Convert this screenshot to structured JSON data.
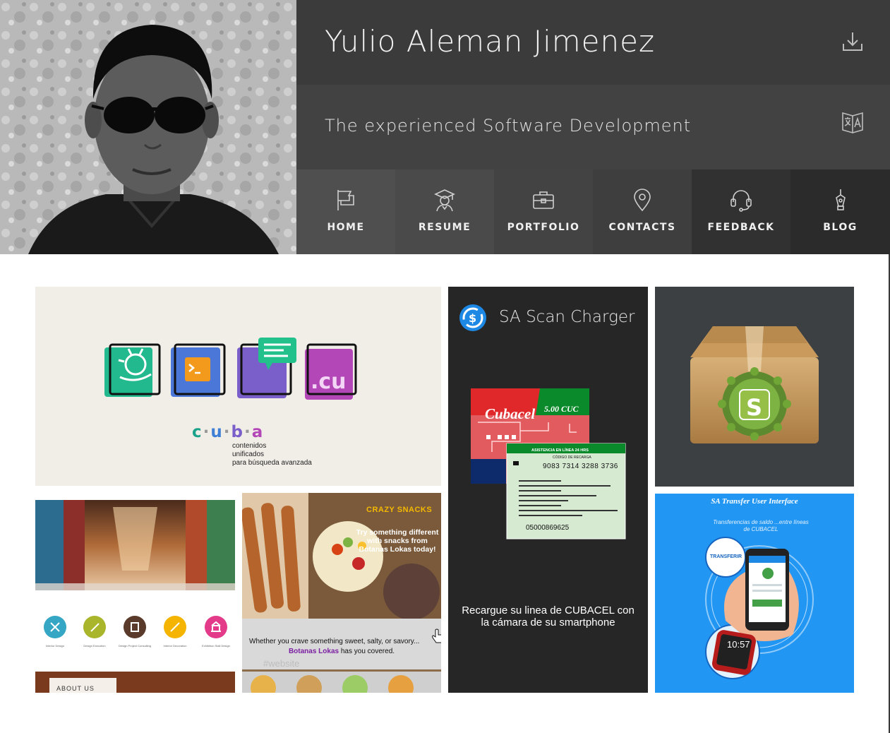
{
  "profile": {
    "name": "Yulio Aleman Jimenez",
    "tagline": "The experienced Software Development",
    "download_icon": "download-icon",
    "language_icon": "translate-icon"
  },
  "nav": {
    "items": [
      {
        "label": "HOME",
        "icon": "flag-icon"
      },
      {
        "label": "RESUME",
        "icon": "graduate-icon"
      },
      {
        "label": "PORTFOLIO",
        "icon": "briefcase-icon"
      },
      {
        "label": "CONTACTS",
        "icon": "map-pin-icon"
      },
      {
        "label": "FEEDBACK",
        "icon": "headset-icon"
      },
      {
        "label": "BLOG",
        "icon": "pen-nib-icon"
      }
    ]
  },
  "portfolio": {
    "cuba": {
      "letters": [
        "c",
        "u",
        "b",
        "a"
      ],
      "subtitle_lines": [
        "contenidos",
        "unificados",
        "para búsqueda avanzada"
      ],
      "app_badge": ".cu"
    },
    "scan": {
      "title": "SA Scan Charger",
      "card_brand": "Cubacel",
      "card_amount": "5.00 CUC",
      "card_help": "ASISTENCIA EN LÍNEA 24 HRS",
      "card_code_label": "CÓDIGO DE RECARGA",
      "card_code": "9083 7314 3288 3736",
      "card_serial": "05000869625",
      "caption": "Recargue su linea de CUBACEL con la cámara de su smartphone"
    },
    "transfer": {
      "title": "SA Transfer User Interface",
      "subtitle": "Transferencias de saldo ...entre líneas de CUBACEL",
      "bubble": "TRANSFERIR",
      "clock": "10:57"
    },
    "snacks": {
      "headline": "CRAZY SNACKS",
      "copy": "Try something different with snacks from Botanas Lokas today!",
      "line1": "Whether you crave something sweet, salty, or savory...",
      "brand": "Botanas Lokas",
      "line2_rest": " has you covered.",
      "tag": "#website"
    },
    "web": {
      "about": "ABOUT US",
      "services": [
        "Interior Design",
        "Design Execution",
        "Design Project Consulting",
        "Interior Decoration",
        "Exhibition Stall Design"
      ]
    }
  },
  "colors": {
    "title_bar": "#3b3b3b",
    "sub_bar": "#424242",
    "scan_bg": "#262626",
    "transfer_bg": "#2196f3",
    "cuba_c": "#1aa38a",
    "cuba_u": "#3f7fd6",
    "cuba_b": "#7a5ec9",
    "cuba_a": "#b347b8"
  }
}
